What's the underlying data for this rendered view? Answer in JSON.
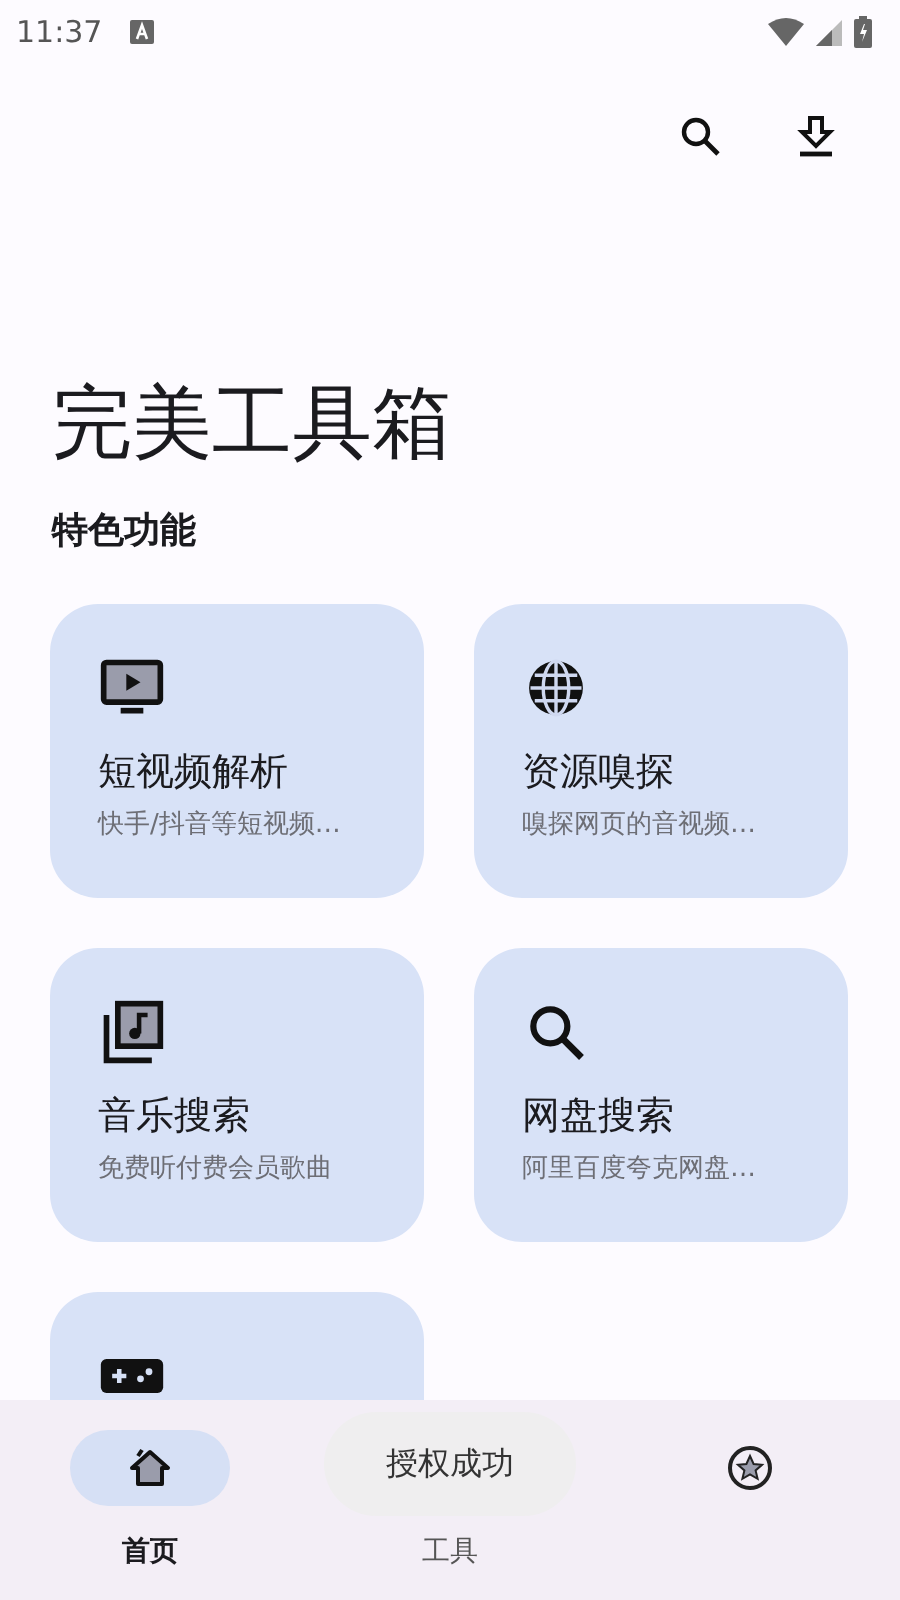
{
  "status_bar": {
    "time": "11:37"
  },
  "title": "完美工具箱",
  "section": "特色功能",
  "features": [
    {
      "kind": "tv",
      "title": "短视频解析",
      "subtitle": "快手/抖音等短视频…"
    },
    {
      "kind": "globe",
      "title": "资源嗅探",
      "subtitle": "嗅探网页的音视频…"
    },
    {
      "kind": "music",
      "title": "音乐搜索",
      "subtitle": "免费听付费会员歌曲"
    },
    {
      "kind": "search",
      "title": "网盘搜索",
      "subtitle": "阿里百度夸克网盘…"
    },
    {
      "kind": "gamepad"
    }
  ],
  "nav": [
    {
      "kind": "home",
      "label": "首页",
      "selected": true
    },
    {
      "kind": "hidden",
      "label": "工具",
      "selected": false
    },
    {
      "kind": "star",
      "selected": false
    }
  ],
  "toast": "授权成功"
}
